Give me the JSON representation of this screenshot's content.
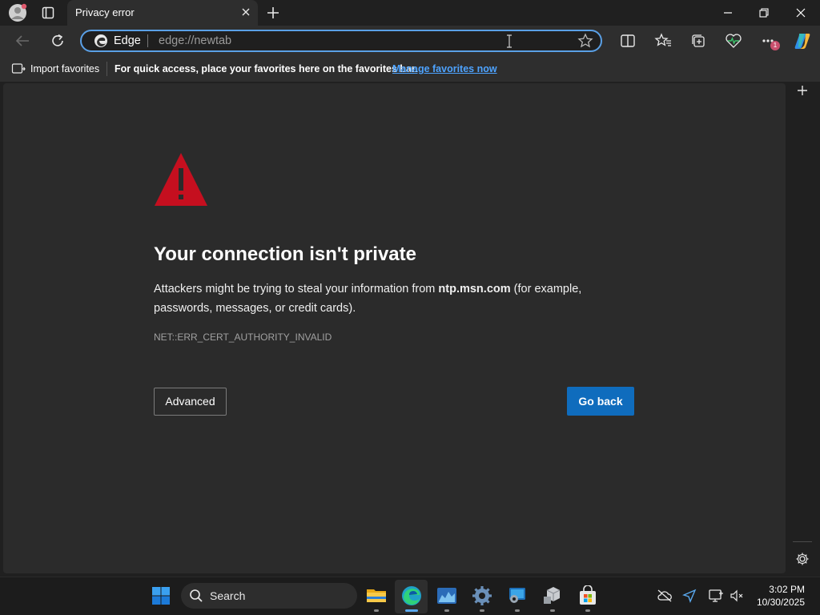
{
  "tab": {
    "title": "Privacy error"
  },
  "omnibox": {
    "site_label": "Edge",
    "url": "edge://newtab"
  },
  "favorites_bar": {
    "import_label": "Import favorites",
    "hint_text": "For quick access, place your favorites here on the favorites bar.",
    "manage_link": "Manage favorites now"
  },
  "error_page": {
    "headline": "Your connection isn't private",
    "body_prefix": "Attackers might be trying to steal your information from ",
    "host": "ntp.msn.com",
    "body_suffix": " (for example, passwords, messages, or credit cards).",
    "error_code": "NET::ERR_CERT_AUTHORITY_INVALID",
    "advanced_label": "Advanced",
    "go_back_label": "Go back"
  },
  "taskbar": {
    "search_placeholder": "Search",
    "time": "3:02 PM",
    "date": "10/30/2025"
  },
  "badges": {
    "notifications": "1"
  },
  "colors": {
    "accent": "#0f6cbd",
    "warning_red": "#c50f1f",
    "link": "#4da3ff",
    "omnibox_border": "#5aa0e6"
  },
  "icons": [
    "profile-avatar-icon",
    "tab-actions-icon",
    "close-icon",
    "new-tab-icon",
    "minimize-icon",
    "restore-icon",
    "window-close-icon",
    "back-icon",
    "refresh-icon",
    "edge-logo-icon",
    "favorite-star-icon",
    "split-screen-icon",
    "favorites-icon",
    "collections-icon",
    "browser-essentials-icon",
    "more-icon",
    "copilot-icon",
    "favorites-folder-icon",
    "warning-icon",
    "add-icon",
    "settings-gear-icon",
    "windows-start-icon",
    "search-icon",
    "file-explorer-icon",
    "edge-taskbar-icon",
    "chart-app-icon",
    "settings-taskbar-icon",
    "tool-app-icon",
    "package-app-icon",
    "store-icon",
    "cloud-off-icon",
    "send-icon",
    "display-icon",
    "volume-muted-icon"
  ]
}
